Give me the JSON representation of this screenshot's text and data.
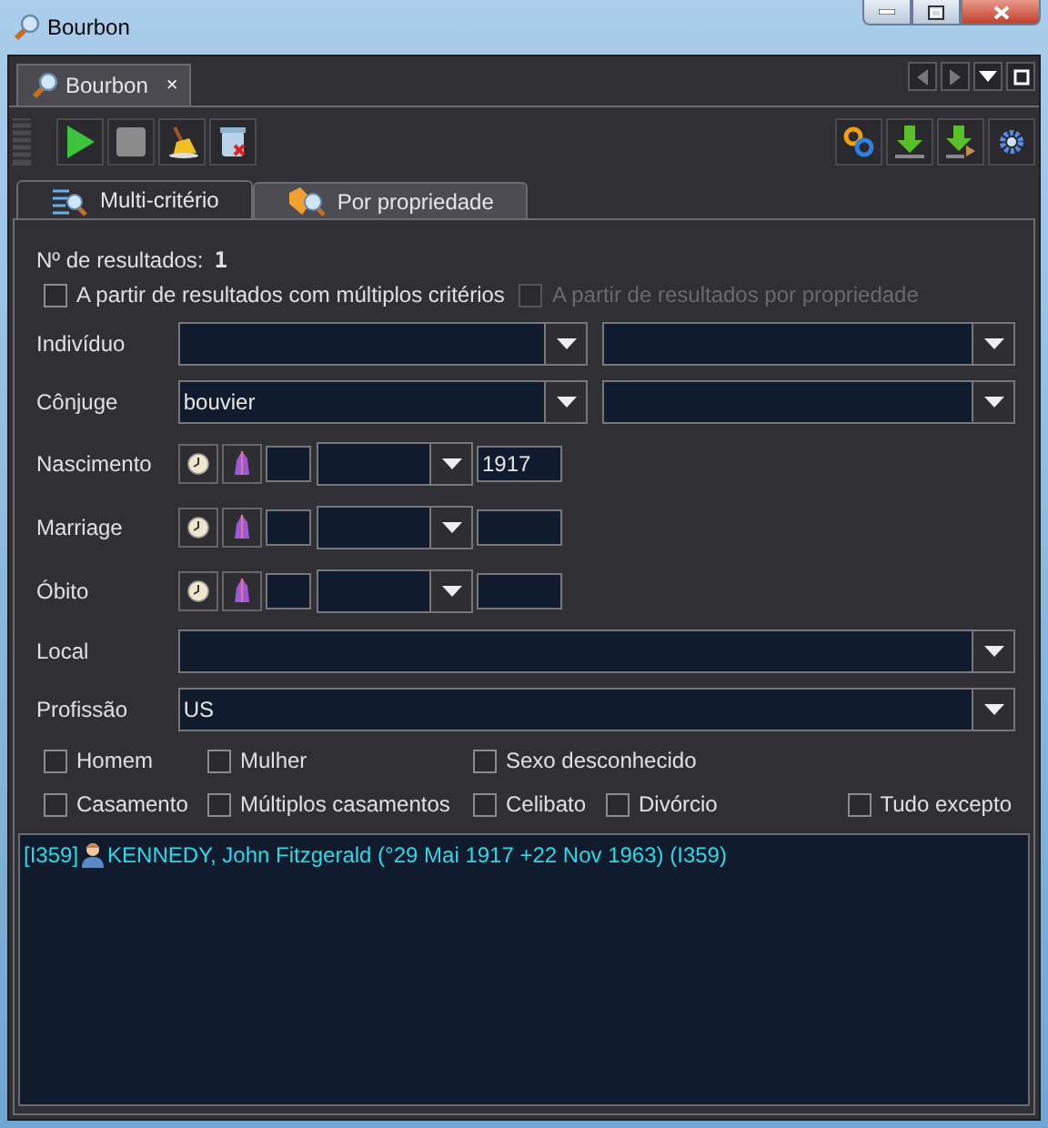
{
  "window": {
    "title": "Bourbon"
  },
  "document_tabs": [
    {
      "label": "Bourbon",
      "selected": true,
      "close": "×"
    }
  ],
  "toolbar": [
    {
      "kind": "run",
      "disabled": false
    },
    {
      "kind": "stop",
      "disabled": true
    },
    {
      "kind": "clean",
      "disabled": false
    },
    {
      "kind": "delete",
      "disabled": false
    }
  ],
  "toolbar_right": [
    {
      "kind": "link",
      "disabled": false
    },
    {
      "kind": "download",
      "disabled": false
    },
    {
      "kind": "download-tree",
      "disabled": false
    },
    {
      "kind": "settings",
      "disabled": false
    }
  ],
  "search_tabs": [
    {
      "label": "Multi-critério",
      "kind": "multi",
      "selected": true
    },
    {
      "label": "Por propriedade",
      "kind": "property",
      "selected": false
    }
  ],
  "result_count": {
    "label": "Nº de resultados:",
    "value": "1"
  },
  "scope_options": [
    {
      "label": "A partir de resultados com múltiplos critérios",
      "checked": false,
      "disabled": false
    },
    {
      "label": "A partir de resultados por propriedade",
      "checked": false,
      "disabled": true
    }
  ],
  "criteria": [
    {
      "kind": "double",
      "label": "Indivíduo"
    },
    {
      "kind": "double",
      "label": "Cônjuge",
      "value": "bouvier"
    },
    {
      "kind": "date",
      "label": "Nascimento",
      "year": "1917"
    },
    {
      "kind": "date",
      "label": "Marriage"
    },
    {
      "kind": "date",
      "label": "Óbito"
    },
    {
      "kind": "single",
      "label": "Local"
    },
    {
      "kind": "single",
      "label": "Profissão",
      "value": "US"
    }
  ],
  "sex_options": [
    {
      "label": "Homem",
      "checked": false
    },
    {
      "label": "Mulher",
      "checked": false
    },
    {
      "label": "Sexo desconhecido",
      "checked": false
    }
  ],
  "family_options": [
    {
      "label": "Casamento",
      "checked": false
    },
    {
      "label": "Múltiplos casamentos",
      "checked": false
    },
    {
      "label": "Celibato",
      "checked": false
    },
    {
      "label": "Divórcio",
      "checked": false
    }
  ],
  "all_except": {
    "label": "Tudo excepto",
    "checked": false
  },
  "results": [
    {
      "kind": "male",
      "text": "[I359]",
      "name": "KENNEDY, John Fitzgerald (°29 Mai 1917 +22 Nov 1963) (I359)"
    }
  ]
}
